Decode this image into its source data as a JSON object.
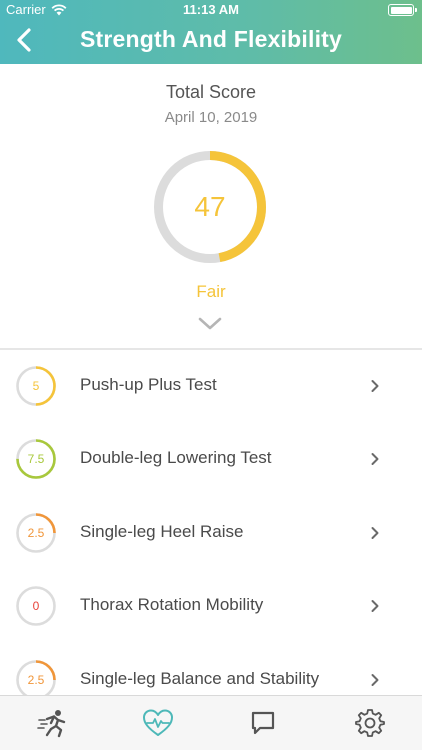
{
  "status_bar": {
    "carrier": "Carrier",
    "time": "11:13 AM"
  },
  "nav": {
    "title": "Strength And Flexibility"
  },
  "summary": {
    "title": "Total Score",
    "date": "April 10, 2019",
    "score": "47",
    "score_fraction": 0.47,
    "rating": "Fair",
    "rating_color": "#f5c43a"
  },
  "tests": [
    {
      "score": "5",
      "name": "Push-up Plus Test",
      "fraction": 0.5,
      "color": "#f5c43a"
    },
    {
      "score": "7.5",
      "name": "Double-leg Lowering Test",
      "fraction": 0.75,
      "color": "#a8c83c"
    },
    {
      "score": "2.5",
      "name": "Single-leg Heel Raise",
      "fraction": 0.25,
      "color": "#f0963a"
    },
    {
      "score": "0",
      "name": "Thorax Rotation Mobility",
      "fraction": 0,
      "color": "#e8433a"
    },
    {
      "score": "2.5",
      "name": "Single-leg Balance and Stability",
      "fraction": 0.25,
      "color": "#f0963a"
    }
  ],
  "tabs": [
    {
      "icon": "running-person-icon",
      "active": false
    },
    {
      "icon": "heart-pulse-icon",
      "active": true
    },
    {
      "icon": "chat-bubble-icon",
      "active": false
    },
    {
      "icon": "gear-icon",
      "active": false
    }
  ],
  "colors": {
    "header_start": "#4fb8bd",
    "header_end": "#6dbf8c",
    "active_tab": "#4db8b8",
    "inactive_tab": "#555555"
  }
}
